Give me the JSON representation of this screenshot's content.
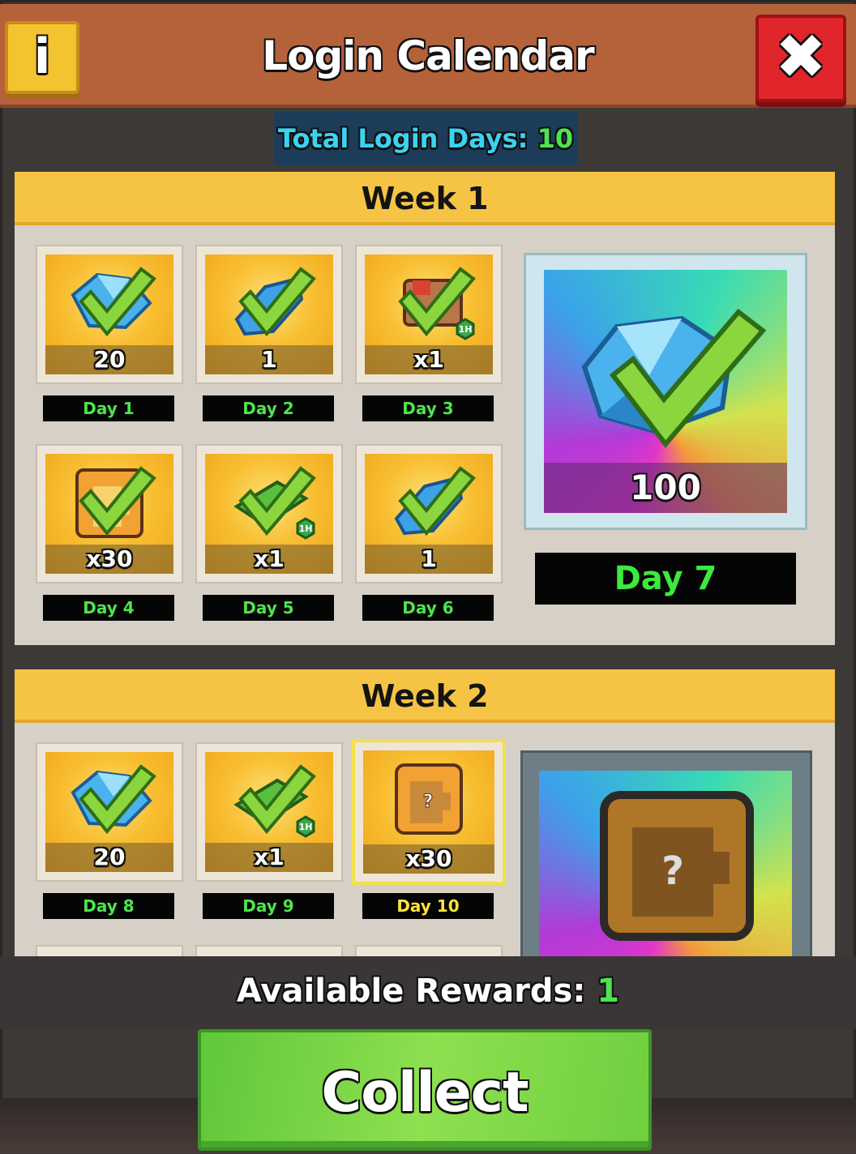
{
  "header": {
    "title": "Login Calendar",
    "info_label": "i",
    "close_label": "✖"
  },
  "total_login": {
    "label": "Total Login Days: ",
    "value": "10"
  },
  "weeks": [
    {
      "title": "Week 1",
      "days": [
        {
          "label": "Day 1",
          "count": "20",
          "reward_icon": "gem-icon",
          "claimed": true
        },
        {
          "label": "Day 2",
          "count": "1",
          "reward_icon": "blue-crystal-icon",
          "claimed": true
        },
        {
          "label": "Day 3",
          "count": "x1",
          "reward_icon": "boost-crate-icon",
          "badge": "1H",
          "claimed": true
        },
        {
          "label": "Day 4",
          "count": "x30",
          "reward_icon": "puzzle-piece-icon",
          "claimed": true
        },
        {
          "label": "Day 5",
          "count": "x1",
          "reward_icon": "cash-icon",
          "badge": "1H",
          "claimed": true
        },
        {
          "label": "Day 6",
          "count": "1",
          "reward_icon": "blue-crystal-icon",
          "claimed": true
        }
      ],
      "big_reward": {
        "label": "Day 7",
        "count": "100",
        "reward_icon": "gem-pile-icon",
        "claimed": true
      }
    },
    {
      "title": "Week 2",
      "days": [
        {
          "label": "Day 8",
          "count": "20",
          "reward_icon": "gem-icon",
          "claimed": true
        },
        {
          "label": "Day 9",
          "count": "x1",
          "reward_icon": "cash-icon",
          "badge": "1H",
          "claimed": true
        },
        {
          "label": "Day 10",
          "count": "x30",
          "reward_icon": "puzzle-piece-icon",
          "claimed": false,
          "current": true
        }
      ],
      "big_reward": {
        "reward_icon": "puzzle-piece-icon",
        "claimed": false
      }
    }
  ],
  "footer": {
    "available_label": "Available Rewards: ",
    "available_value": "1",
    "collect_label": "Collect"
  },
  "colors": {
    "header": "#b5623a",
    "week_header": "#f6c444",
    "claimed_day_text": "#4ee44e",
    "current_day_text": "#ffe23a",
    "collect_button": "#7ad646",
    "close_button": "#e0262a",
    "info_button": "#f4c430"
  }
}
